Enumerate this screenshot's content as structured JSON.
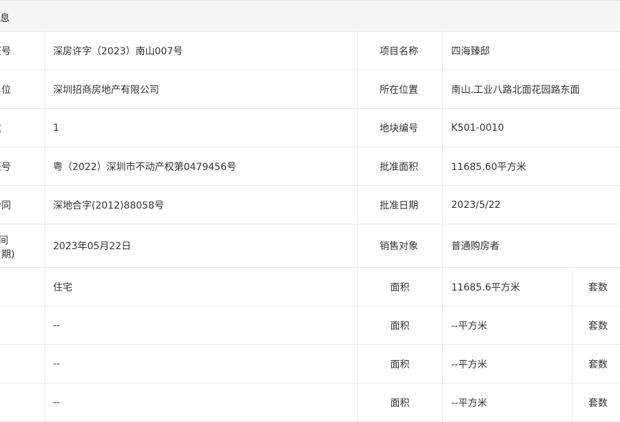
{
  "header": {
    "title": "信息"
  },
  "rows": [
    {
      "label": "证号",
      "value1": "深房许字（2023）南山007号",
      "label2": "项目名称",
      "value2": "四海臻邸"
    },
    {
      "label": "单位",
      "value1": "深圳招商房地产有限公司",
      "label2": "所在位置",
      "value2": "南山.工业八路北面花园路东面"
    },
    {
      "label": "数",
      "value1": "1",
      "label2": "地块编号",
      "value2": "K501-0010"
    },
    {
      "label": "证号",
      "value1": "粤（2022）深圳市不动产权第0479456号",
      "label2": "批准面积",
      "value2": "11685.60平方米"
    },
    {
      "label": "合同",
      "value1": "深地合字(2012)88058号",
      "label2": "批准日期",
      "value2": "2023/5/22"
    },
    {
      "label_top": "间",
      "label_bottom": "日期)",
      "value1": "2023年05月22日",
      "label2": "销售对象",
      "value2": "普通购房者"
    }
  ],
  "usage_rows": [
    {
      "value1": "住宅",
      "label2": "面积",
      "value2": "11685.6平方米",
      "label3": "套数"
    },
    {
      "value1": "--",
      "label2": "面积",
      "value2": "--平方米",
      "label3": "套数"
    },
    {
      "value1": "--",
      "label2": "面积",
      "value2": "--平方米",
      "label3": "套数"
    },
    {
      "value1": "--",
      "label2": "面积",
      "value2": "--平方米",
      "label3": "套数"
    }
  ]
}
